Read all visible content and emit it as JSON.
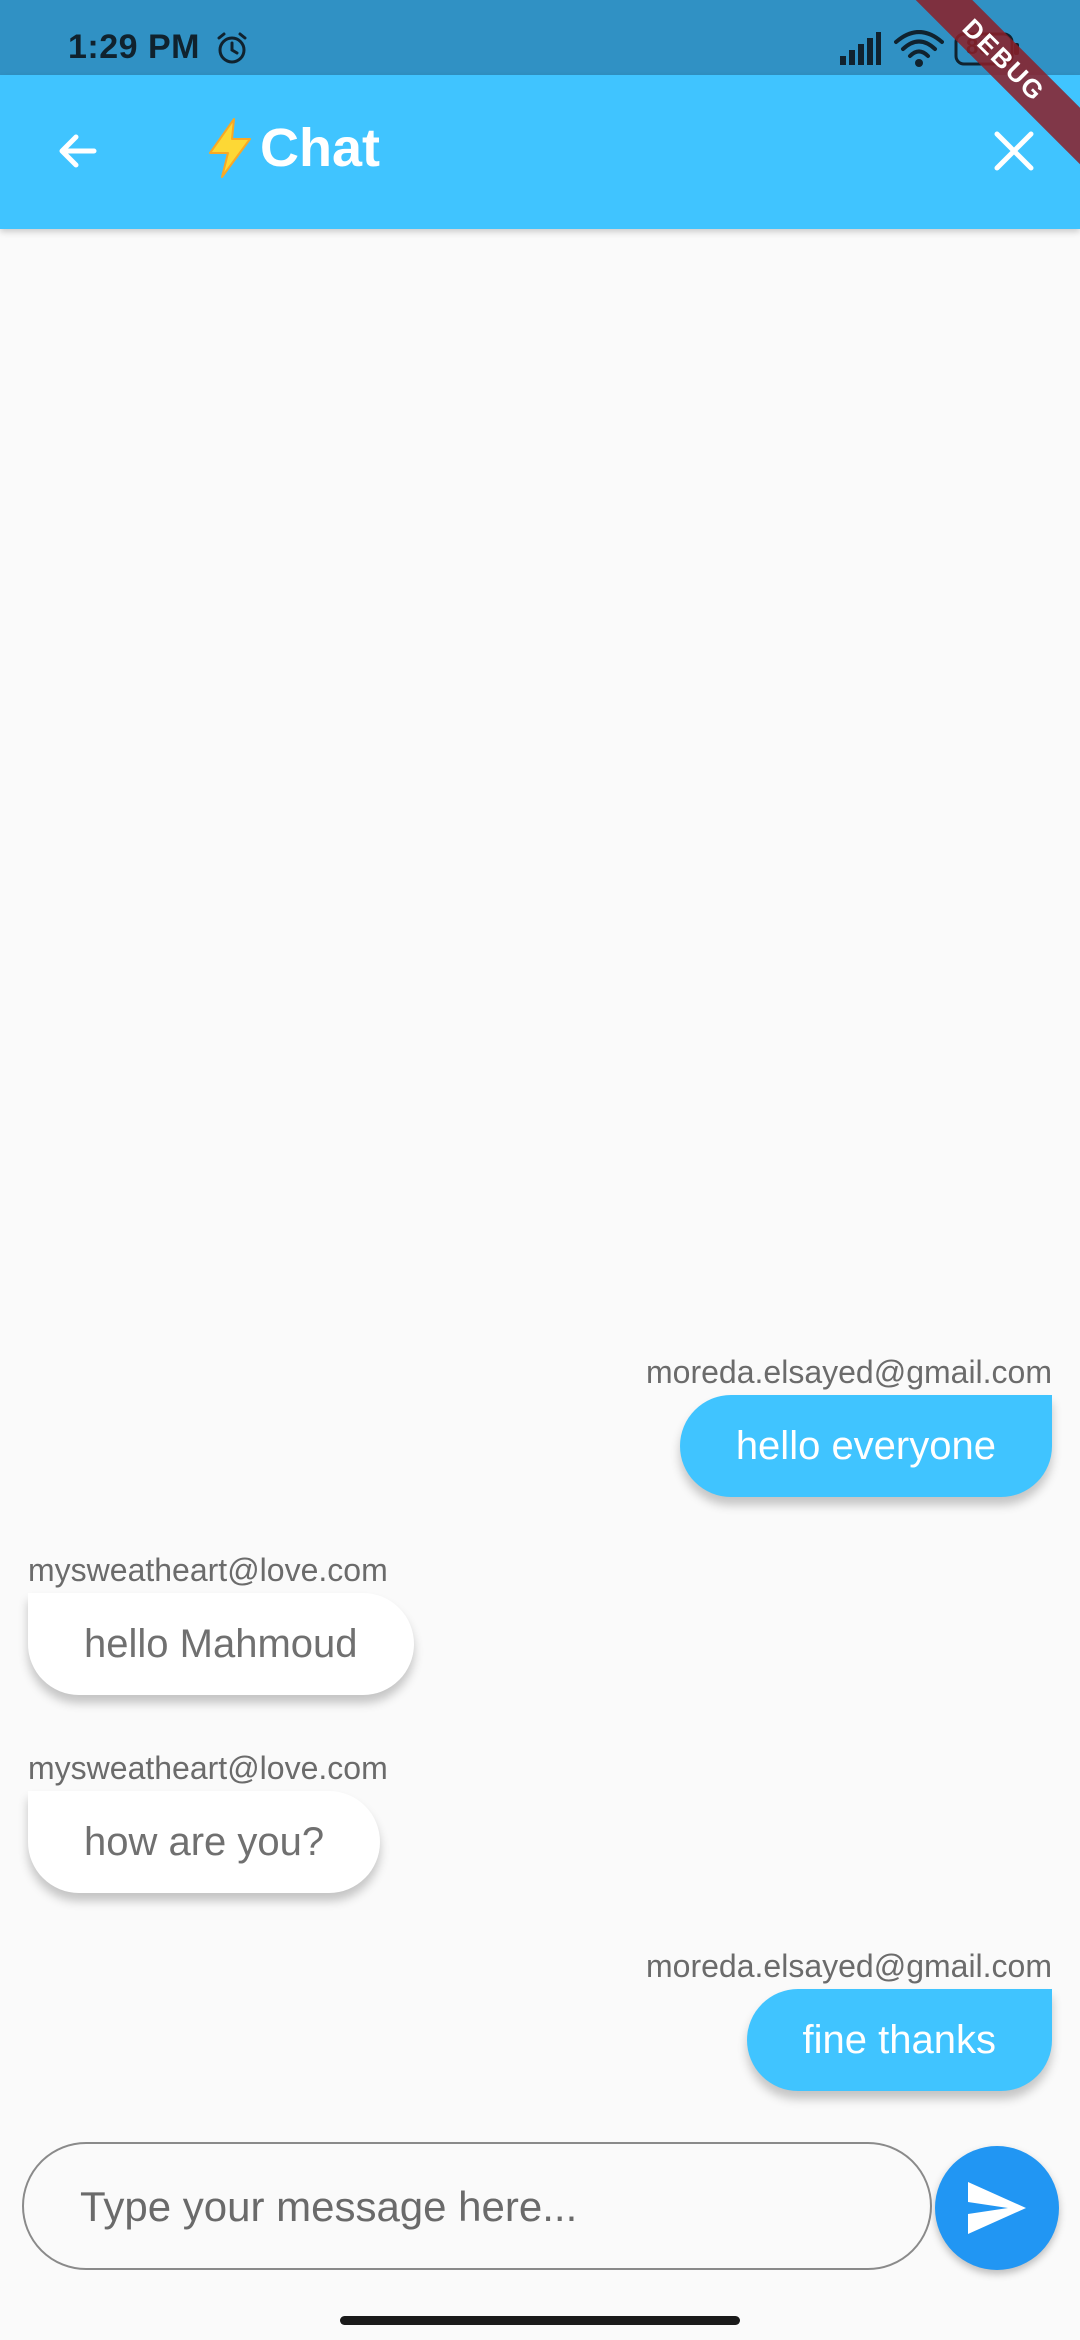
{
  "status_bar": {
    "time": "1:29 PM",
    "battery_level": "80",
    "icons": [
      "alarm-icon",
      "signal-icon",
      "wifi-icon",
      "battery-icon"
    ]
  },
  "debug_banner": "DEBUG",
  "app_bar": {
    "title_emoji_icon": "lightning-bolt-icon",
    "title": "Chat",
    "back_icon": "arrow-back-icon",
    "close_icon": "close-icon"
  },
  "messages": [
    {
      "sender": "moreda.elsayed@gmail.com",
      "text": "hello everyone",
      "side": "right"
    },
    {
      "sender": "mysweatheart@love.com",
      "text": "hello Mahmoud",
      "side": "left"
    },
    {
      "sender": "mysweatheart@love.com",
      "text": "how are you?",
      "side": "left"
    },
    {
      "sender": "moreda.elsayed@gmail.com",
      "text": "fine thanks",
      "side": "right"
    }
  ],
  "composer": {
    "placeholder": "Type your message here...",
    "value": "",
    "send_icon": "send-icon"
  },
  "colors": {
    "status_bar": "#3091c4",
    "app_bar": "#40c4ff",
    "my_bubble": "#40c4ff",
    "other_bubble": "#ffffff",
    "send_button": "#2196f3",
    "background": "#fafafa"
  }
}
